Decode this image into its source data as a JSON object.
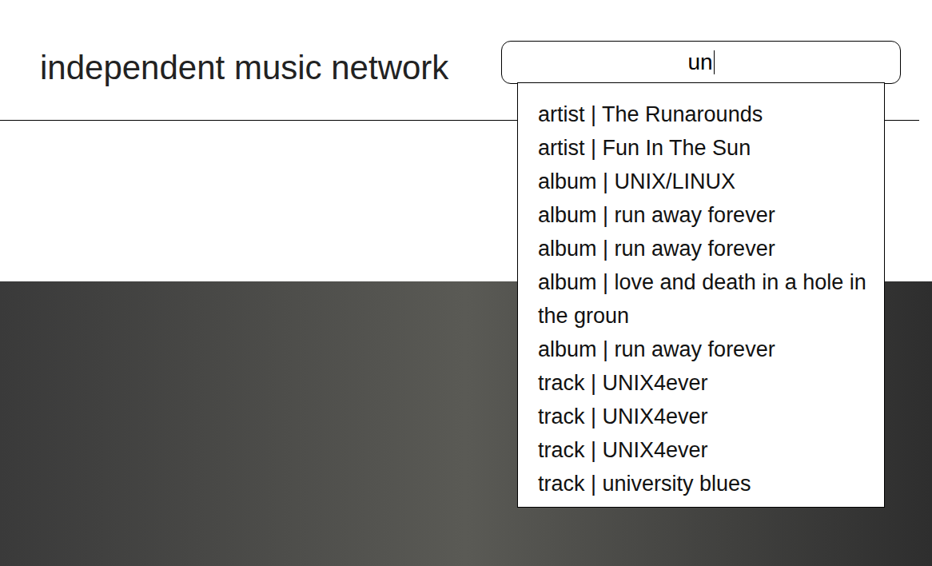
{
  "site": {
    "title": "independent music network"
  },
  "search": {
    "value": "un",
    "focused": true
  },
  "suggestions": [
    {
      "label": "artist | The Runarounds"
    },
    {
      "label": "artist | Fun In The Sun"
    },
    {
      "label": "album | UNIX/LINUX"
    },
    {
      "label": "album | run away forever"
    },
    {
      "label": "album | run away forever"
    },
    {
      "label": "album | love and death in a hole in the groun"
    },
    {
      "label": "album | run away forever"
    },
    {
      "label": "track | UNIX4ever"
    },
    {
      "label": "track | UNIX4ever"
    },
    {
      "label": "track | UNIX4ever"
    },
    {
      "label": "track | university blues"
    }
  ]
}
